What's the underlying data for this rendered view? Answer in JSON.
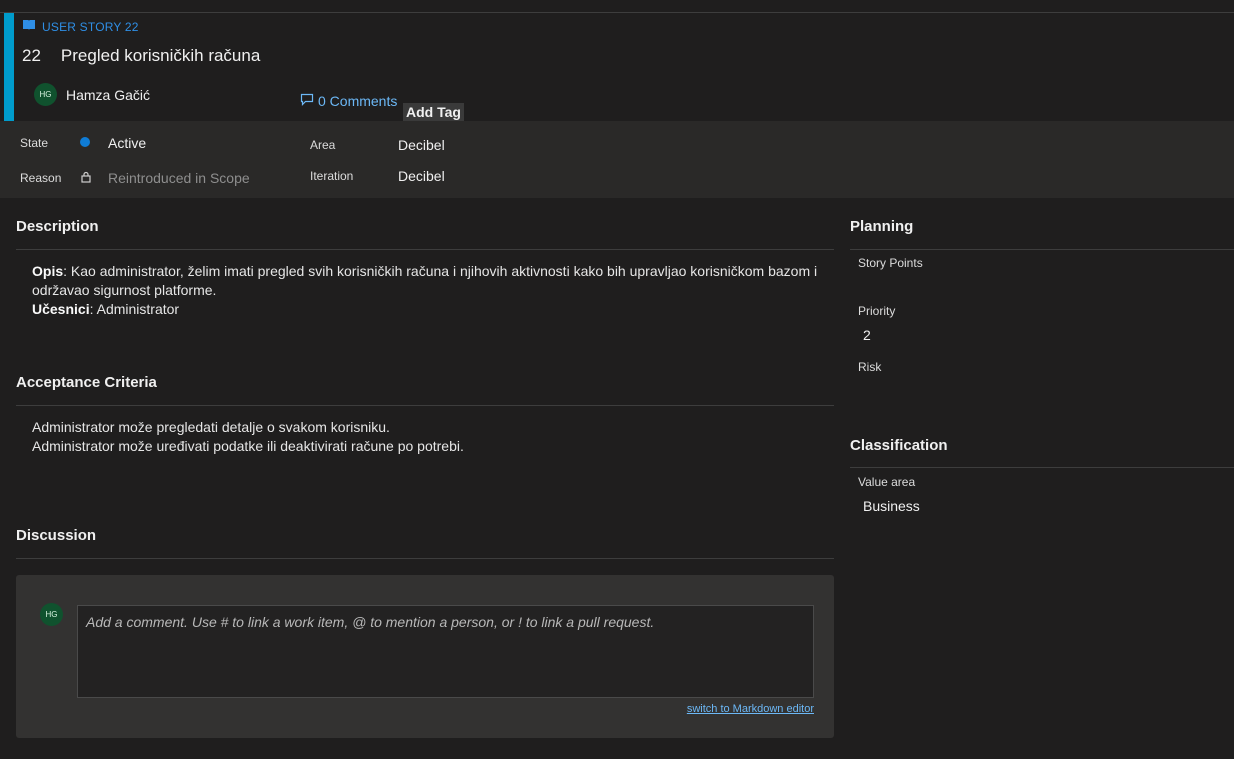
{
  "work_item": {
    "type_label": "USER STORY 22",
    "id": "22",
    "title": "Pregled korisničkih računa",
    "assignee_initials": "HG",
    "assignee_name": "Hamza Gačić",
    "comments_label": "0 Comments",
    "add_tag_label": "Add Tag",
    "accent_color": "#009ccc"
  },
  "fields": {
    "state_label": "State",
    "state_value": "Active",
    "reason_label": "Reason",
    "reason_value": "Reintroduced in Scope",
    "area_label": "Area",
    "area_value": "Decibel",
    "iteration_label": "Iteration",
    "iteration_value": "Decibel"
  },
  "description": {
    "title": "Description",
    "opis_label": "Opis",
    "opis_text": ": Kao administrator, želim imati pregled svih korisničkih računa i njihovih aktivnosti kako bih upravljao korisničkom bazom i održavao sigurnost platforme.",
    "ucesnici_label": "Učesnici",
    "ucesnici_text": ": Administrator"
  },
  "acceptance": {
    "title": "Acceptance Criteria",
    "lines": [
      "Administrator može pregledati detalje o svakom korisniku.",
      "Administrator može uređivati podatke ili deaktivirati račune po potrebi."
    ]
  },
  "discussion": {
    "title": "Discussion",
    "avatar_initials": "HG",
    "placeholder": "Add a comment. Use # to link a work item, @ to mention a person, or ! to link a pull request.",
    "markdown_link": "switch to Markdown editor"
  },
  "planning": {
    "title": "Planning",
    "story_points_label": "Story Points",
    "priority_label": "Priority",
    "priority_value": "2",
    "risk_label": "Risk"
  },
  "classification": {
    "title": "Classification",
    "value_area_label": "Value area",
    "value_area_value": "Business"
  }
}
